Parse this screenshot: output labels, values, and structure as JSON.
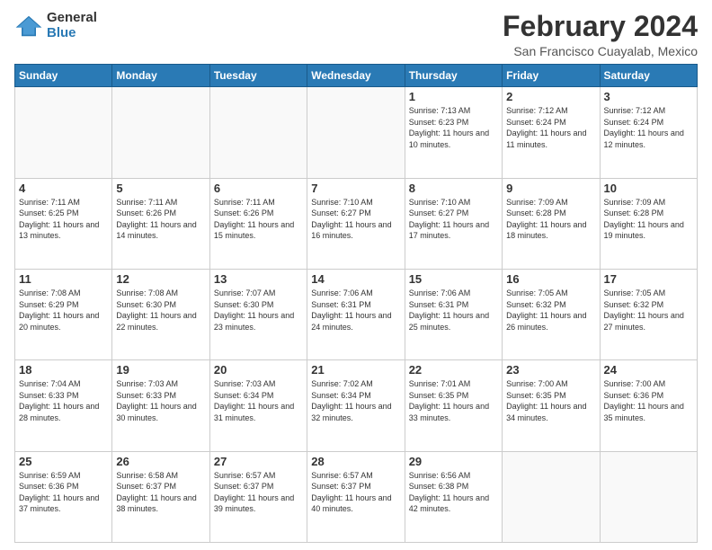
{
  "header": {
    "logo_general": "General",
    "logo_blue": "Blue",
    "main_title": "February 2024",
    "subtitle": "San Francisco Cuayalab, Mexico"
  },
  "calendar": {
    "days_of_week": [
      "Sunday",
      "Monday",
      "Tuesday",
      "Wednesday",
      "Thursday",
      "Friday",
      "Saturday"
    ],
    "weeks": [
      [
        {
          "day": "",
          "info": ""
        },
        {
          "day": "",
          "info": ""
        },
        {
          "day": "",
          "info": ""
        },
        {
          "day": "",
          "info": ""
        },
        {
          "day": "1",
          "info": "Sunrise: 7:13 AM\nSunset: 6:23 PM\nDaylight: 11 hours\nand 10 minutes."
        },
        {
          "day": "2",
          "info": "Sunrise: 7:12 AM\nSunset: 6:24 PM\nDaylight: 11 hours\nand 11 minutes."
        },
        {
          "day": "3",
          "info": "Sunrise: 7:12 AM\nSunset: 6:24 PM\nDaylight: 11 hours\nand 12 minutes."
        }
      ],
      [
        {
          "day": "4",
          "info": "Sunrise: 7:11 AM\nSunset: 6:25 PM\nDaylight: 11 hours\nand 13 minutes."
        },
        {
          "day": "5",
          "info": "Sunrise: 7:11 AM\nSunset: 6:26 PM\nDaylight: 11 hours\nand 14 minutes."
        },
        {
          "day": "6",
          "info": "Sunrise: 7:11 AM\nSunset: 6:26 PM\nDaylight: 11 hours\nand 15 minutes."
        },
        {
          "day": "7",
          "info": "Sunrise: 7:10 AM\nSunset: 6:27 PM\nDaylight: 11 hours\nand 16 minutes."
        },
        {
          "day": "8",
          "info": "Sunrise: 7:10 AM\nSunset: 6:27 PM\nDaylight: 11 hours\nand 17 minutes."
        },
        {
          "day": "9",
          "info": "Sunrise: 7:09 AM\nSunset: 6:28 PM\nDaylight: 11 hours\nand 18 minutes."
        },
        {
          "day": "10",
          "info": "Sunrise: 7:09 AM\nSunset: 6:28 PM\nDaylight: 11 hours\nand 19 minutes."
        }
      ],
      [
        {
          "day": "11",
          "info": "Sunrise: 7:08 AM\nSunset: 6:29 PM\nDaylight: 11 hours\nand 20 minutes."
        },
        {
          "day": "12",
          "info": "Sunrise: 7:08 AM\nSunset: 6:30 PM\nDaylight: 11 hours\nand 22 minutes."
        },
        {
          "day": "13",
          "info": "Sunrise: 7:07 AM\nSunset: 6:30 PM\nDaylight: 11 hours\nand 23 minutes."
        },
        {
          "day": "14",
          "info": "Sunrise: 7:06 AM\nSunset: 6:31 PM\nDaylight: 11 hours\nand 24 minutes."
        },
        {
          "day": "15",
          "info": "Sunrise: 7:06 AM\nSunset: 6:31 PM\nDaylight: 11 hours\nand 25 minutes."
        },
        {
          "day": "16",
          "info": "Sunrise: 7:05 AM\nSunset: 6:32 PM\nDaylight: 11 hours\nand 26 minutes."
        },
        {
          "day": "17",
          "info": "Sunrise: 7:05 AM\nSunset: 6:32 PM\nDaylight: 11 hours\nand 27 minutes."
        }
      ],
      [
        {
          "day": "18",
          "info": "Sunrise: 7:04 AM\nSunset: 6:33 PM\nDaylight: 11 hours\nand 28 minutes."
        },
        {
          "day": "19",
          "info": "Sunrise: 7:03 AM\nSunset: 6:33 PM\nDaylight: 11 hours\nand 30 minutes."
        },
        {
          "day": "20",
          "info": "Sunrise: 7:03 AM\nSunset: 6:34 PM\nDaylight: 11 hours\nand 31 minutes."
        },
        {
          "day": "21",
          "info": "Sunrise: 7:02 AM\nSunset: 6:34 PM\nDaylight: 11 hours\nand 32 minutes."
        },
        {
          "day": "22",
          "info": "Sunrise: 7:01 AM\nSunset: 6:35 PM\nDaylight: 11 hours\nand 33 minutes."
        },
        {
          "day": "23",
          "info": "Sunrise: 7:00 AM\nSunset: 6:35 PM\nDaylight: 11 hours\nand 34 minutes."
        },
        {
          "day": "24",
          "info": "Sunrise: 7:00 AM\nSunset: 6:36 PM\nDaylight: 11 hours\nand 35 minutes."
        }
      ],
      [
        {
          "day": "25",
          "info": "Sunrise: 6:59 AM\nSunset: 6:36 PM\nDaylight: 11 hours\nand 37 minutes."
        },
        {
          "day": "26",
          "info": "Sunrise: 6:58 AM\nSunset: 6:37 PM\nDaylight: 11 hours\nand 38 minutes."
        },
        {
          "day": "27",
          "info": "Sunrise: 6:57 AM\nSunset: 6:37 PM\nDaylight: 11 hours\nand 39 minutes."
        },
        {
          "day": "28",
          "info": "Sunrise: 6:57 AM\nSunset: 6:37 PM\nDaylight: 11 hours\nand 40 minutes."
        },
        {
          "day": "29",
          "info": "Sunrise: 6:56 AM\nSunset: 6:38 PM\nDaylight: 11 hours\nand 42 minutes."
        },
        {
          "day": "",
          "info": ""
        },
        {
          "day": "",
          "info": ""
        }
      ]
    ]
  }
}
